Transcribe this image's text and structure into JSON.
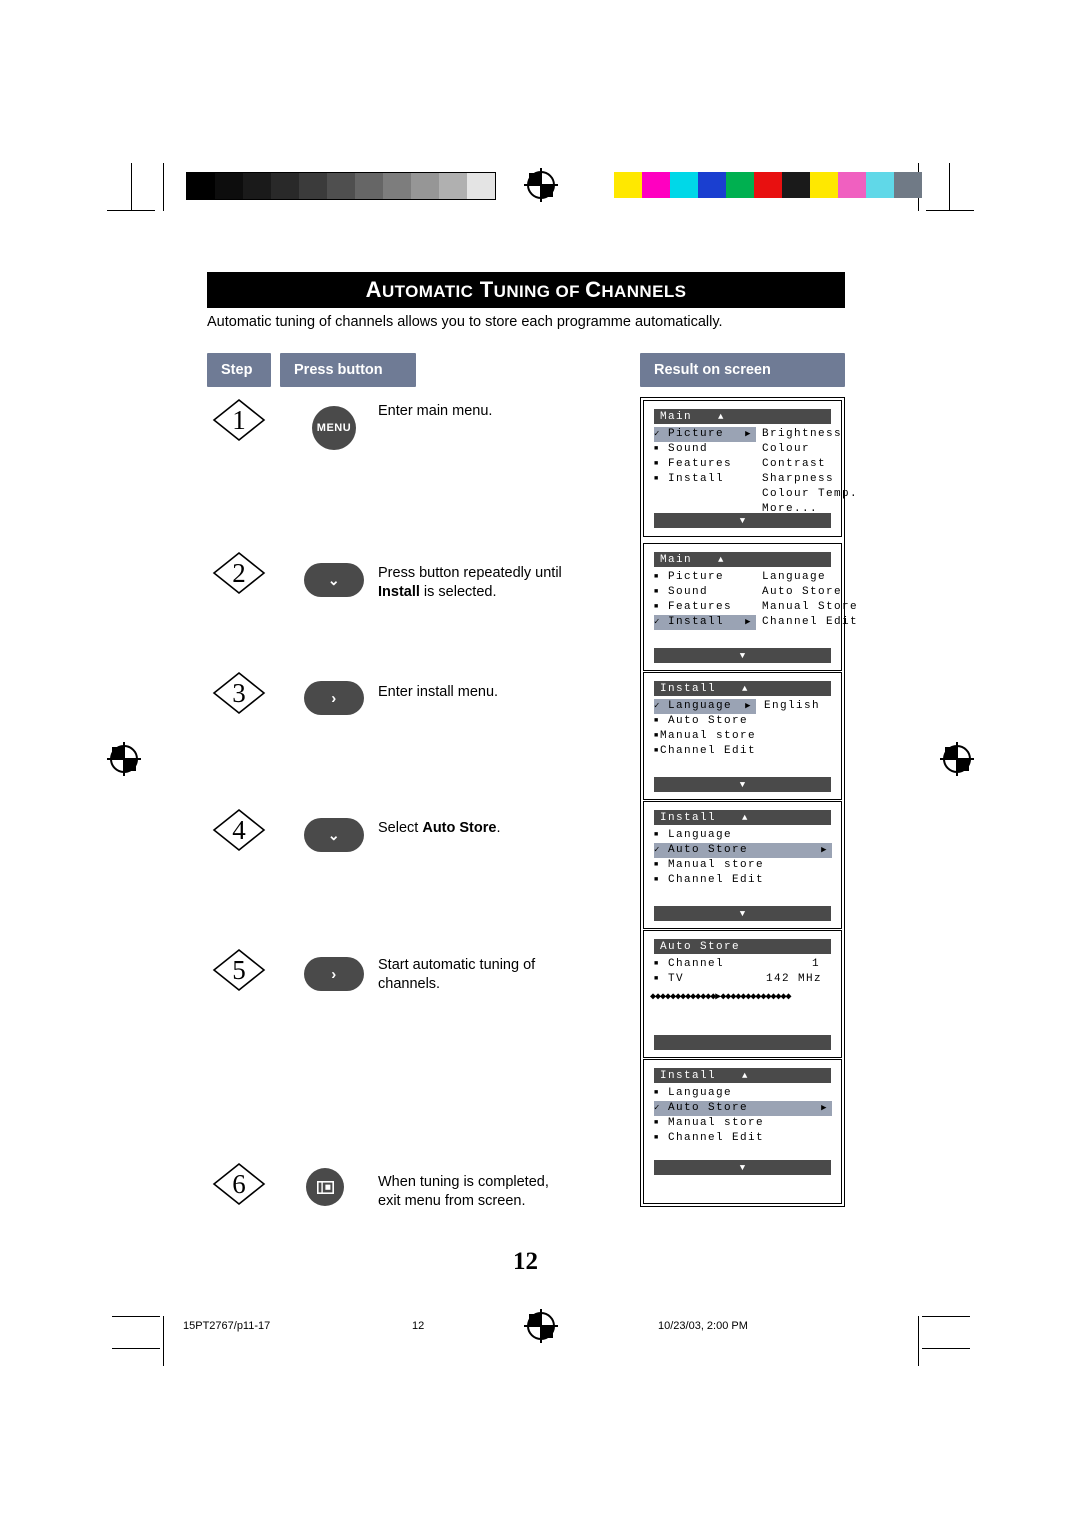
{
  "header": {
    "title_caps": [
      "A",
      "T",
      "C"
    ],
    "title": "AUTOMATIC TUNING OF CHANNELS",
    "title_parts": [
      "A",
      "UTOMATIC",
      "T",
      "UNING OF ",
      "C",
      "HANNELS"
    ]
  },
  "intro": "Automatic tuning of channels allows you to store each programme automatically.",
  "columns": {
    "step": "Step",
    "press_button": "Press button",
    "result": "Result on screen"
  },
  "steps": [
    {
      "num": "1",
      "button": "MENU",
      "button_type": "round-text",
      "text_html": "Enter main menu."
    },
    {
      "num": "2",
      "button": "∨",
      "button_type": "pill-chevron",
      "text_line1": "Press button repeatedly until",
      "text_line2_bold": "Install",
      "text_line2_rest": " is selected."
    },
    {
      "num": "3",
      "button": "›",
      "button_type": "pill-chevron",
      "text_html": "Enter install menu."
    },
    {
      "num": "4",
      "button": "∨",
      "button_type": "pill-chevron",
      "text_pre": "Select ",
      "text_bold": "Auto Store",
      "text_post": "."
    },
    {
      "num": "5",
      "button": "›",
      "button_type": "pill-chevron",
      "text_line1": "Start automatic tuning of",
      "text_line2": "channels."
    },
    {
      "num": "6",
      "button": "▣",
      "button_type": "round-icon",
      "text_line1": "When tuning is completed,",
      "text_line2": "exit menu from screen."
    }
  ],
  "osd": [
    {
      "title": "Main",
      "left_items": [
        {
          "mark": "check",
          "label": "Picture",
          "selected": true,
          "arrow": true
        },
        {
          "mark": "square",
          "label": "Sound"
        },
        {
          "mark": "square",
          "label": "Features"
        },
        {
          "mark": "square",
          "label": "Install"
        }
      ],
      "right_items": [
        "Brightness",
        "Colour",
        "Contrast",
        "Sharpness",
        "Colour Temp.",
        "More..."
      ],
      "bottom_arrow": "▼"
    },
    {
      "title": "Main",
      "left_items": [
        {
          "mark": "square",
          "label": "Picture"
        },
        {
          "mark": "square",
          "label": "Sound"
        },
        {
          "mark": "square",
          "label": "Features"
        },
        {
          "mark": "check",
          "label": "Install",
          "selected": true,
          "arrow": true
        }
      ],
      "right_items": [
        "Language",
        "Auto Store",
        "Manual Store",
        "Channel Edit"
      ],
      "bottom_arrow": "▼"
    },
    {
      "title": "Install",
      "left_items": [
        {
          "mark": "check",
          "label": "Language",
          "selected": true,
          "arrow": true
        },
        {
          "mark": "square",
          "label": "Auto Store"
        },
        {
          "mark": "square",
          "label": "Manual store"
        },
        {
          "mark": "square",
          "label": "Channel Edit"
        }
      ],
      "right_items": [
        "English"
      ],
      "bottom_arrow": "▼"
    },
    {
      "title": "Install",
      "left_items": [
        {
          "mark": "square",
          "label": "Language"
        },
        {
          "mark": "check",
          "label": "Auto Store",
          "selected": true,
          "arrow": true
        },
        {
          "mark": "square",
          "label": "Manual store"
        },
        {
          "mark": "square",
          "label": "Channel Edit"
        }
      ],
      "right_items": [],
      "bottom_arrow": "▼"
    },
    {
      "title": "Auto Store",
      "kv": [
        {
          "mark": "square",
          "key": "Channel",
          "value": "1"
        },
        {
          "mark": "square",
          "key": "TV",
          "value": "142 MHz"
        }
      ],
      "progress": "◆◆◆◆◆◆◆◆◆◆◆◆◆▶◆◆◆◆◆◆◆◆◆◆◆◆◆◆",
      "bottom_arrow": ""
    },
    {
      "title": "Install",
      "left_items": [
        {
          "mark": "square",
          "label": "Language"
        },
        {
          "mark": "check",
          "label": "Auto Store",
          "selected": true,
          "arrow": true
        },
        {
          "mark": "square",
          "label": "Manual store"
        },
        {
          "mark": "square",
          "label": "Channel Edit"
        }
      ],
      "right_items": [],
      "bottom_arrow": "▼"
    }
  ],
  "page_number": "12",
  "footer": {
    "left": "15PT2767/p11-17",
    "center": "12",
    "right": "10/23/03, 2:00 PM"
  },
  "colors": {
    "header_band": "#000000",
    "column_header": "#6f7b95",
    "osd_bar": "#4a4a4a",
    "osd_highlight": "#9aa3b4",
    "button": "#4a4a4a"
  },
  "colorbar_swatches": [
    "#ffe800",
    "#ff00c0",
    "#00d8e8",
    "#1a3fd0",
    "#00b050",
    "#e81010",
    "#1a1a1a",
    "#ffe800",
    "#f060c0",
    "#60d8e8",
    "#707a86"
  ],
  "grayscale_steps": [
    "#000000",
    "#0d0d0d",
    "#1a1a1a",
    "#292929",
    "#3b3b3b",
    "#4f4f4f",
    "#666666",
    "#7d7d7d",
    "#969696",
    "#b0b0b0",
    "#cacaca",
    "#e4e4e4",
    "#ffffff"
  ]
}
